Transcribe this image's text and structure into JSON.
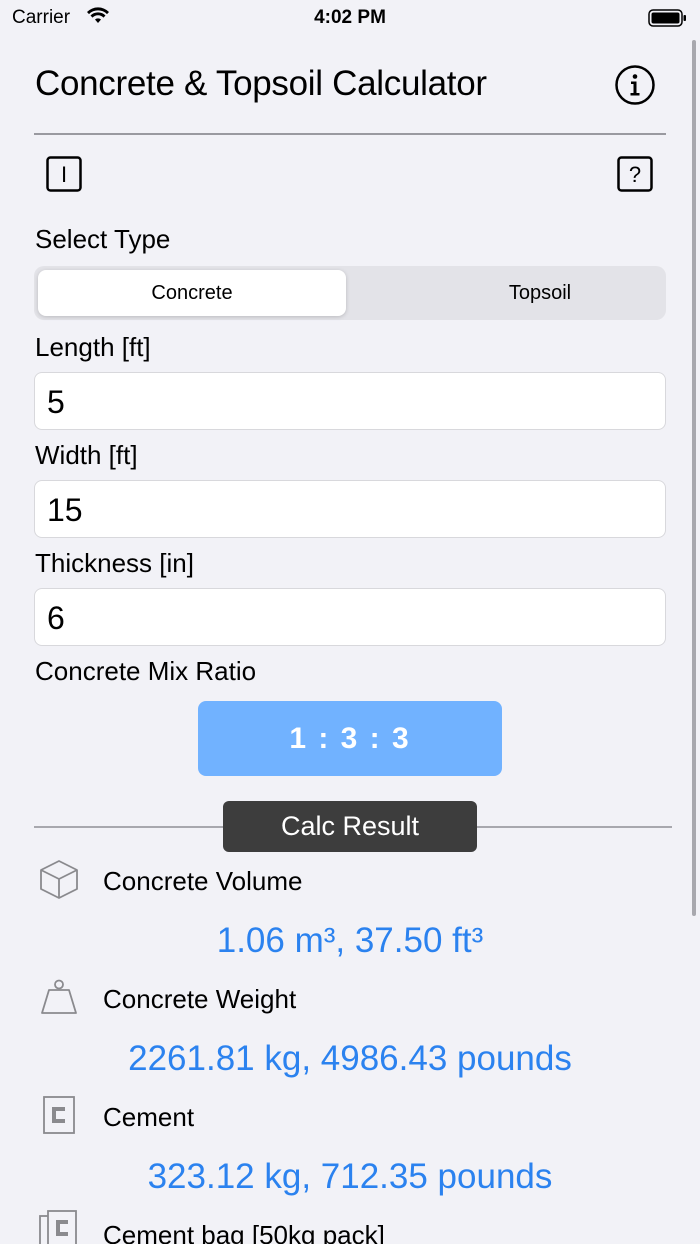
{
  "status": {
    "carrier": "Carrier",
    "time": "4:02 PM"
  },
  "header": {
    "title": "Concrete & Topsoil Calculator"
  },
  "toolbar": {
    "left_glyph": "I",
    "right_glyph": "?"
  },
  "type_section": {
    "label": "Select Type",
    "options": [
      "Concrete",
      "Topsoil"
    ],
    "selected": "Concrete"
  },
  "inputs": {
    "length": {
      "label": "Length [ft]",
      "value": "5"
    },
    "width": {
      "label": "Width [ft]",
      "value": "15"
    },
    "thickness": {
      "label": "Thickness [in]",
      "value": "6"
    }
  },
  "mix": {
    "label": "Concrete Mix Ratio",
    "value": "1 : 3 : 3"
  },
  "results": {
    "heading": "Calc Result",
    "items": [
      {
        "icon": "cube-icon",
        "label": "Concrete Volume",
        "value": "1.06 m³, 37.50 ft³"
      },
      {
        "icon": "weight-icon",
        "label": "Concrete Weight",
        "value": "2261.81 kg, 4986.43 pounds"
      },
      {
        "icon": "cement-icon",
        "label": "Cement",
        "value": "323.12 kg, 712.35 pounds"
      },
      {
        "icon": "cement-bags-icon",
        "label": "Cement bag [50kg pack]",
        "value": ""
      }
    ]
  },
  "colors": {
    "accent": "#2b82ef",
    "mix_button": "#71b2ff",
    "background": "#f2f2f7"
  }
}
